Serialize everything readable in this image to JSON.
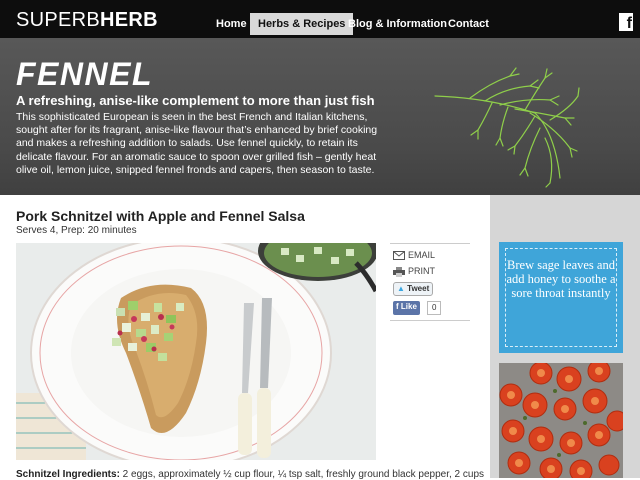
{
  "nav": {
    "logo_light": "SUPERB",
    "logo_bold": "HERB",
    "items": [
      {
        "label": "Home",
        "active": false
      },
      {
        "label": "Herbs & Recipes",
        "active": true
      },
      {
        "label": "Blog & Information",
        "active": false
      },
      {
        "label": "Contact",
        "active": false
      }
    ],
    "facebook_icon": "facebook-icon"
  },
  "hero": {
    "title": "FENNEL",
    "subtitle": "A refreshing, anise-like complement to more than just fish",
    "body": "This sophisticated European is seen in the best French and Italian kitchens, sought after for its fragrant, anise-like flavour that’s enhanced by brief cooking and makes a refreshing addition to salads. Use fennel quickly, to retain its delicate flavour. For an aromatic sauce to spoon over grilled fish – gently heat olive oil, lemon juice, snipped fennel fronds and capers, then season to taste."
  },
  "recipe": {
    "title": "Pork Schnitzel with Apple and Fennel Salsa",
    "serves": "Serves 4, Prep: 20 minutes",
    "ingredients_label": "Schnitzel Ingredients:",
    "ingredients_text": " 2 eggs, approximately ½ cup flour, ¼ tsp salt, freshly ground black pepper, 2 cups"
  },
  "share": {
    "email": "EMAIL",
    "print": "PRINT",
    "tweet": "Tweet",
    "like": "Like",
    "like_count": "0"
  },
  "sidebar": {
    "tip": "Brew sage leaves and add honey to soothe a sore throat instantly"
  },
  "colors": {
    "nav_bg": "#0d0d0d",
    "hero_bg": "#4f4f4f",
    "tip_bg": "#3fa5d9",
    "sidebar_bg": "#d6d6d6"
  }
}
